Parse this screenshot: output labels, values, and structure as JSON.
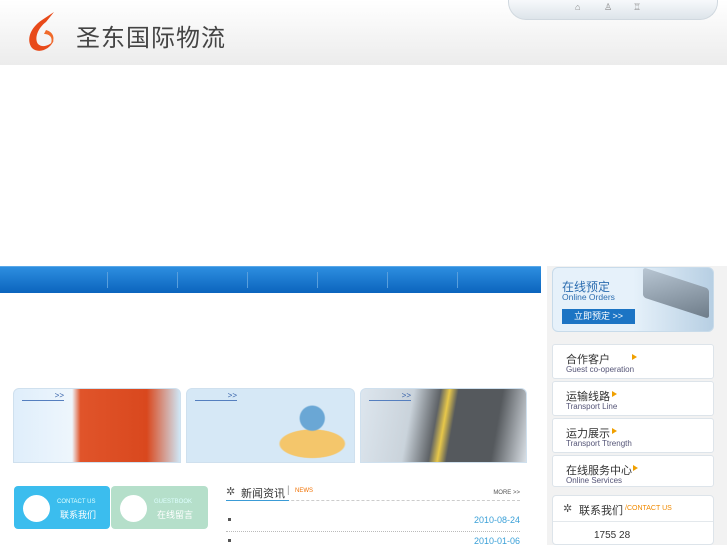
{
  "header": {
    "brand": "圣东国际物流",
    "top_links": [
      "home-icon",
      "sitemap-icon",
      "favorite-icon"
    ]
  },
  "nav": {
    "items": [
      "",
      "",
      "",
      "",
      "",
      "",
      "",
      ""
    ]
  },
  "cards": [
    {
      "more": ">>"
    },
    {
      "more": ">>"
    },
    {
      "more": ">>"
    }
  ],
  "sidebar": {
    "orders": {
      "title": "在线预定",
      "subtitle": "Online Orders",
      "button": "立即预定 >>"
    },
    "menu": [
      {
        "cn": "合作客户",
        "en": "Guest co-operation"
      },
      {
        "cn": "运输线路",
        "en": "Transport Line"
      },
      {
        "cn": "运力展示",
        "en": "Transport Ttrength"
      },
      {
        "cn": "在线服务中心",
        "en": "Online Services"
      }
    ],
    "contact": {
      "title": "联系我们",
      "subtitle": "/CONTACT US",
      "phone": "1755 28"
    }
  },
  "quick": [
    {
      "en": "CONTACT US",
      "cn": "联系我们",
      "color": "#3bbdee"
    },
    {
      "en": "GUESTBOOK",
      "cn": "在线留言",
      "color": "#b5dfca"
    }
  ],
  "news": {
    "title": "新闻资讯",
    "tag": "NEWS",
    "more": "MORE >>",
    "items": [
      {
        "date": "2010-08-24"
      },
      {
        "date": "2010-01-06"
      }
    ]
  }
}
